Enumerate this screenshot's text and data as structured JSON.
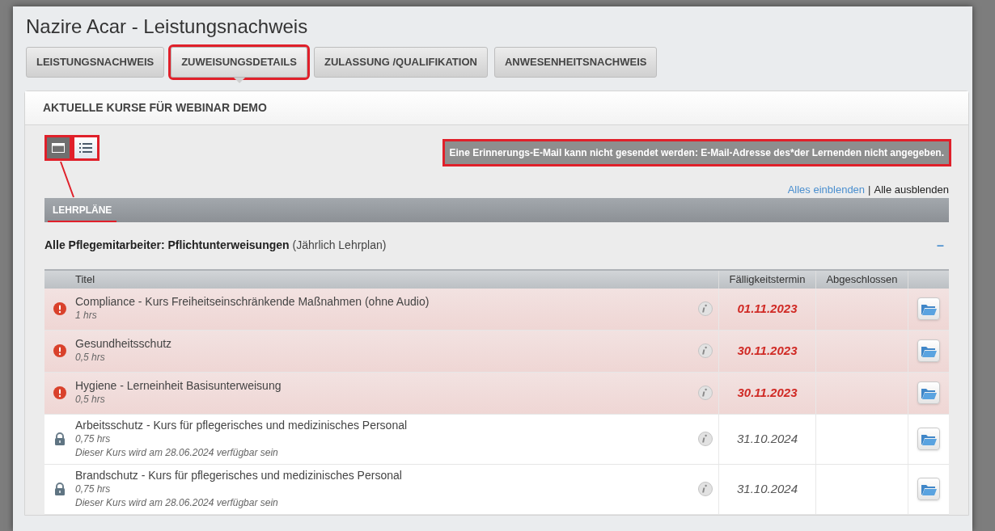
{
  "title": "Nazire Acar - Leistungsnachweis",
  "tabs": [
    {
      "label": "LEISTUNGSNACHWEIS",
      "selected": false,
      "highlighted": false
    },
    {
      "label": "ZUWEISUNGSDETAILS",
      "selected": true,
      "highlighted": true
    },
    {
      "label": "ZULASSUNG /QUALIFIKATION",
      "selected": false,
      "highlighted": false
    },
    {
      "label": "ANWESENHEITSNACHWEIS",
      "selected": false,
      "highlighted": false
    }
  ],
  "panel": {
    "title": "AKTUELLE KURSE FÜR WEBINAR DEMO",
    "view_buttons": [
      {
        "kind": "card",
        "selected": true
      },
      {
        "kind": "list",
        "selected": false
      }
    ],
    "message": "Eine Erinnerungs-E-Mail kann nicht gesendet werden: E-Mail-Adresse des*der Lernenden nicht angegeben.",
    "expand_all": "Alles einblenden",
    "separator": "|",
    "collapse_all": "Alle ausblenden",
    "section": "LEHRPLÄNE",
    "curriculum": {
      "name": "Alle Pflegemitarbeiter: Pflichtunterweisungen",
      "type": "(Jährlich Lehrplan)",
      "toggle": "–",
      "expanded": true
    },
    "table": {
      "columns": [
        "Titel",
        "Fälligkeitstermin",
        "Abgeschlossen"
      ],
      "rows": [
        {
          "kind": "overdue",
          "title": "Compliance - Kurs Freiheitseinschränkende Maßnahmen (ohne Audio)",
          "hours": "1 hrs",
          "due": "01.11.2023"
        },
        {
          "kind": "overdue",
          "title": "Gesundheitsschutz",
          "hours": "0,5 hrs",
          "due": "30.11.2023"
        },
        {
          "kind": "overdue",
          "title": "Hygiene - Lerneinheit Basisunterweisung",
          "hours": "0,5 hrs",
          "due": "30.11.2023"
        },
        {
          "kind": "locked",
          "title": "Arbeitsschutz - Kurs für pflegerisches und medizinisches Personal",
          "hours": "0,75 hrs",
          "note": "Dieser Kurs wird am 28.06.2024 verfügbar sein",
          "due": "31.10.2024"
        },
        {
          "kind": "locked",
          "title": "Brandschutz - Kurs für pflegerisches und medizinisches Personal",
          "hours": "0,75 hrs",
          "note": "Dieser Kurs wird am 28.06.2024 verfügbar sein",
          "due": "31.10.2024"
        }
      ]
    }
  }
}
